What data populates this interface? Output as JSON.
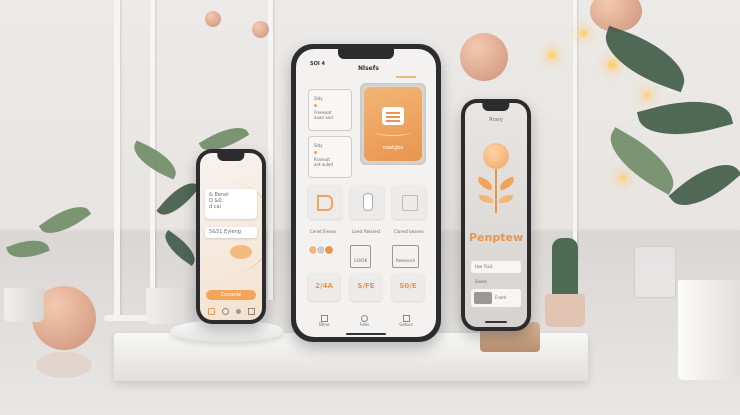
{
  "colors": {
    "accent": "#f0a35a",
    "phone_frame": "#2c2c2e",
    "screen_bg": "#f4f2f0"
  },
  "center_phone": {
    "status_left": "SOI 4",
    "title": "Nlsefs",
    "card1": {
      "title": "Sldy",
      "line1": "Freeeaat",
      "line2": "auan and"
    },
    "card2": {
      "title": "Sldy",
      "line1": "Rraneat",
      "line2": "ant auled"
    },
    "feature_button": "noatgbo",
    "row2_labels": [
      "Cenet Ereses",
      "Loest Relarest",
      "Ciorest beaves"
    ],
    "chip_label": "LSVOK",
    "chip_label2": "Reeesceil",
    "stat_tiles": [
      "2/4A",
      "S/FE",
      "S0/E"
    ],
    "nav_labels": [
      "Bhne",
      "Fdes",
      "Gelocs"
    ]
  },
  "left_phone": {
    "line1": "& Benel",
    "line2": "Q &0.",
    "line3": "d cai",
    "button_label": "5&51 Eyleng",
    "bottom_button": "Cnnanle"
  },
  "right_phone": {
    "top_label": "Rrary",
    "brand": "Penptew",
    "row1": "tlxe Tsa3",
    "row2": "Sosen",
    "row3": "Fnedr"
  }
}
